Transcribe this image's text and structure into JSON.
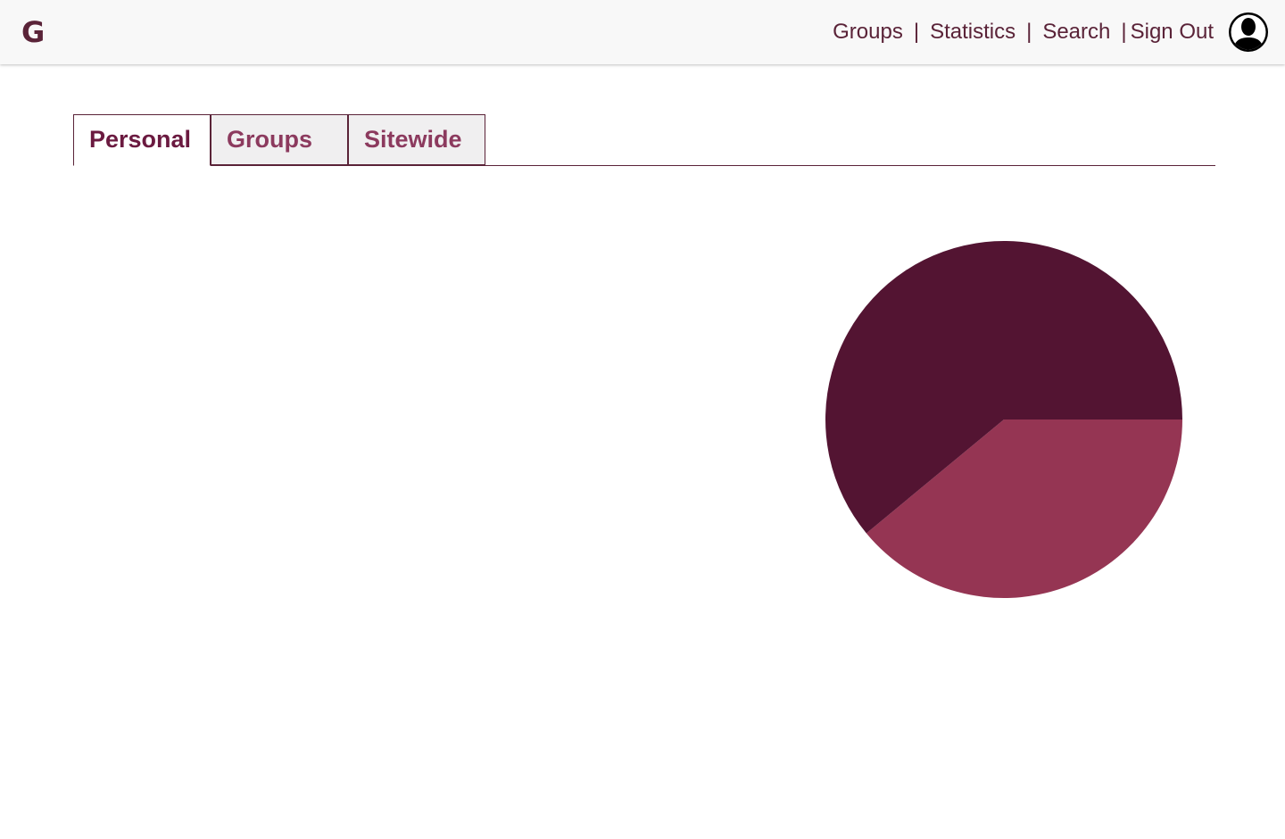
{
  "header": {
    "logo": "G",
    "nav": [
      {
        "label": "Groups"
      },
      {
        "label": "Statistics"
      },
      {
        "label": "Search"
      },
      {
        "label": "Sign Out"
      }
    ],
    "separator": "|",
    "avatar_icon": "user-silhouette-icon"
  },
  "tabs": [
    {
      "label": "Personal",
      "active": true
    },
    {
      "label": "Groups",
      "active": false
    },
    {
      "label": "Sitewide",
      "active": false
    }
  ],
  "colors": {
    "brand": "#5a2338",
    "tab_active_text": "#6b1a40",
    "tab_inactive_text": "#8c3a5e",
    "slice_dark": "#531432",
    "slice_light": "#953553"
  },
  "chart_data": {
    "type": "pie",
    "values": [
      61,
      39
    ],
    "colors": [
      "#531432",
      "#953553"
    ]
  }
}
